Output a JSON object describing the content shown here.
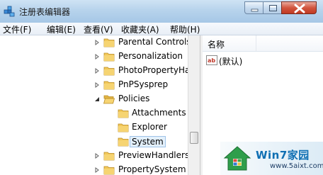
{
  "window": {
    "title": "注册表编辑器"
  },
  "menu": [
    "文件(F)",
    "编辑(E)",
    "查看(V)",
    "收藏夹(A)",
    "帮助(H)"
  ],
  "tree": {
    "nodes": [
      {
        "label": "Parental Controls",
        "expanded": false,
        "selected": false
      },
      {
        "label": "Personalization",
        "expanded": false,
        "selected": false
      },
      {
        "label": "PhotoPropertyHa",
        "expanded": false,
        "selected": false
      },
      {
        "label": "PnPSysprep",
        "expanded": false,
        "selected": false
      },
      {
        "label": "Policies",
        "expanded": true,
        "selected": false
      },
      {
        "label": "Attachments",
        "expanded": false,
        "selected": false
      },
      {
        "label": "Explorer",
        "expanded": false,
        "selected": false
      },
      {
        "label": "System",
        "expanded": false,
        "selected": true
      },
      {
        "label": "PreviewHandlers",
        "expanded": false,
        "selected": false
      },
      {
        "label": "PropertySystem",
        "expanded": false,
        "selected": false
      }
    ]
  },
  "values_pane": {
    "column_name": "名称",
    "rows": [
      {
        "name": "(默认)",
        "icon": "reg-sz-ab-icon"
      }
    ]
  },
  "watermark": {
    "brand": "Win7家园",
    "url": "www.5aixt.com"
  },
  "colors": {
    "folder": "#f2c85a",
    "title_bar": "#b7d3ec",
    "close_button": "#c94a33",
    "watermark_text": "#0f6fb3"
  }
}
